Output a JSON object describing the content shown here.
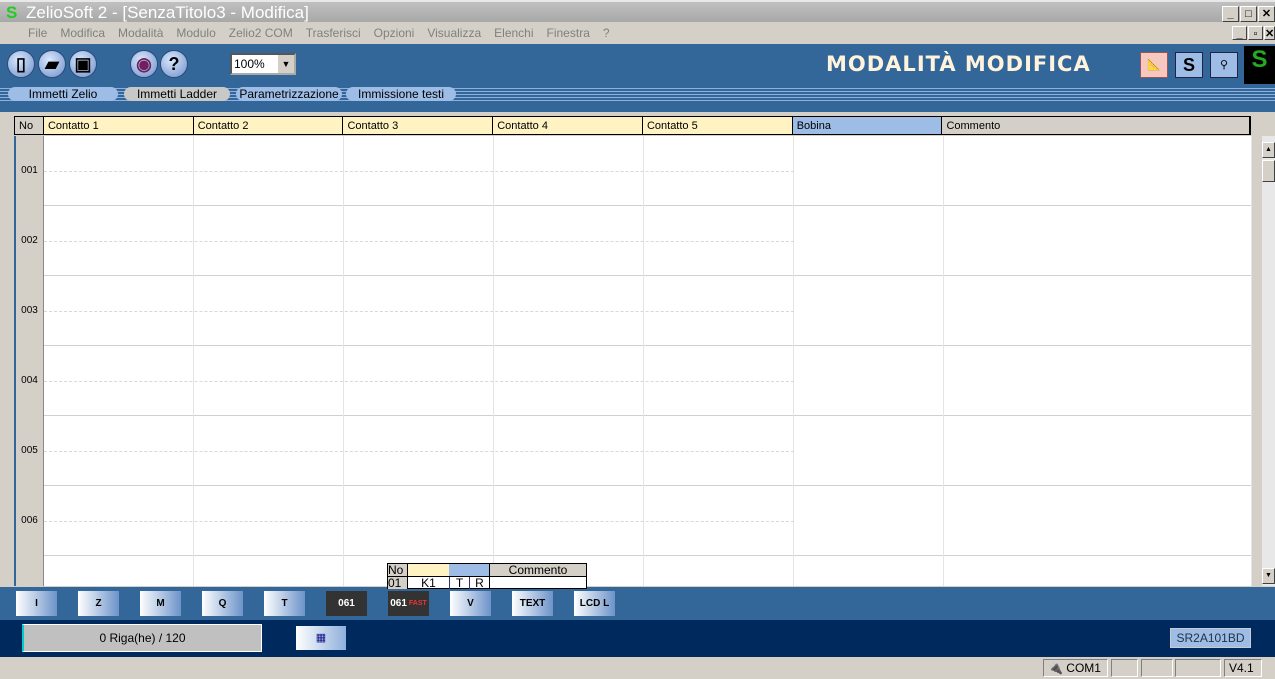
{
  "window": {
    "title": "ZelioSoft 2 - [SenzaTitolo3 - Modifica]",
    "minimize": "_",
    "maximize": "□",
    "close": "✕",
    "restore": "🗗"
  },
  "menu": [
    "File",
    "Modifica",
    "Modalità",
    "Modulo",
    "Zelio2 COM",
    "Trasferisci",
    "Opzioni",
    "Visualizza",
    "Elenchi",
    "Finestra",
    "?"
  ],
  "toolbar": {
    "zoom": "100%",
    "mode_label": "MODALITÀ MODIFICA",
    "icons": [
      "new-icon",
      "open-icon",
      "save-icon",
      "view-icon",
      "help-icon"
    ],
    "s_button": "S"
  },
  "tabs": [
    {
      "label": "Immetti Zelio"
    },
    {
      "label": "Immetti Ladder",
      "active": true
    },
    {
      "label": "Parametrizzazione"
    },
    {
      "label": "Immissione testi"
    }
  ],
  "grid": {
    "headers": [
      "No",
      "Contatto 1",
      "Contatto 2",
      "Contatto 3",
      "Contatto 4",
      "Contatto 5",
      "Bobina",
      "Commento"
    ],
    "rows": [
      "001",
      "002",
      "003",
      "004",
      "005",
      "006",
      ""
    ],
    "header_color": "#fff3c4",
    "coil_color": "#9dbde6"
  },
  "tooltip_table": {
    "headers": [
      "No",
      "",
      "",
      "Commento"
    ],
    "row": [
      "01",
      "K1",
      "T",
      "R",
      ""
    ]
  },
  "function_buttons": [
    {
      "name": "contact",
      "label": "I"
    },
    {
      "name": "zx",
      "label": "Z"
    },
    {
      "name": "aux-relay",
      "label": "M"
    },
    {
      "name": "output",
      "label": "Q"
    },
    {
      "name": "timer",
      "label": "T"
    },
    {
      "name": "counter",
      "label": "061"
    },
    {
      "name": "fast-counter",
      "label": "061",
      "sub": "FAST"
    },
    {
      "name": "comparator",
      "label": "V"
    },
    {
      "name": "text",
      "label": "TEXT"
    },
    {
      "name": "lcd",
      "label": "LCD L"
    }
  ],
  "footer": {
    "rows": "0 Riga(he) / 120",
    "module": "SR2A101BD"
  },
  "status": {
    "port": "COM1",
    "version": "V4.1"
  }
}
